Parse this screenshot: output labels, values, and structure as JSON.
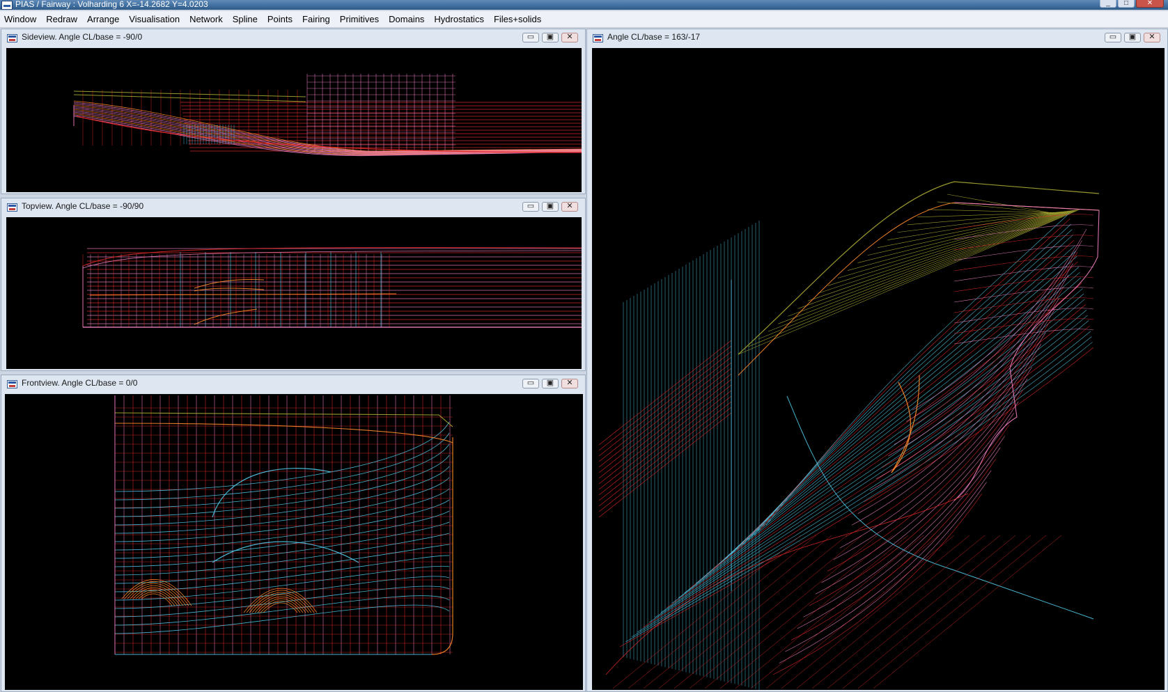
{
  "titlebar": {
    "title": "PIAS / Fairway : Volharding 6  X=-14.2682 Y=4.0203"
  },
  "menu": [
    "Window",
    "Redraw",
    "Arrange",
    "Visualisation",
    "Network",
    "Spline",
    "Points",
    "Fairing",
    "Primitives",
    "Domains",
    "Hydrostatics",
    "Files+solids"
  ],
  "windows": {
    "side": {
      "title": "Sideview. Angle CL/base = -90/0"
    },
    "top": {
      "title": "Topview. Angle CL/base = -90/90"
    },
    "front": {
      "title": "Frontview. Angle CL/base = 0/0"
    },
    "persp": {
      "title": "Angle CL/base = 163/-17"
    }
  },
  "window_buttons": {
    "minimize": "▭",
    "maximize": "▣",
    "close": "✕"
  },
  "colors": {
    "background": "#000000",
    "red": "#e02828",
    "cyan": "#4fc7e6",
    "pink": "#f080c0",
    "orange": "#ff8a2a",
    "olive": "#a8a832"
  }
}
